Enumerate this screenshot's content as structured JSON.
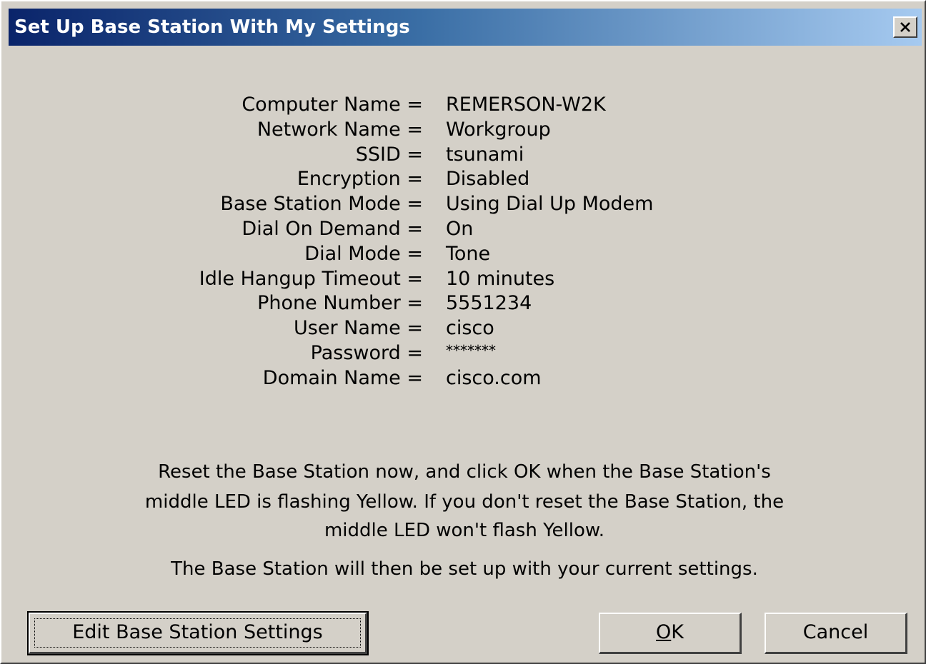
{
  "window": {
    "title": "Set Up Base Station With My Settings",
    "close_glyph": "×"
  },
  "settings": [
    {
      "label": "Computer Name =",
      "value": "REMERSON-W2K"
    },
    {
      "label": "Network Name =",
      "value": "Workgroup"
    },
    {
      "label": "SSID =",
      "value": "tsunami"
    },
    {
      "label": "Encryption =",
      "value": "Disabled"
    },
    {
      "label": "Base Station Mode =",
      "value": "Using Dial Up Modem"
    },
    {
      "label": "Dial On Demand =",
      "value": "On"
    },
    {
      "label": "Dial Mode =",
      "value": "Tone"
    },
    {
      "label": "Idle Hangup Timeout =",
      "value": "10 minutes"
    },
    {
      "label": "Phone Number =",
      "value": "5551234"
    },
    {
      "label": "User Name =",
      "value": "cisco"
    },
    {
      "label": "Password =",
      "value": "*******"
    },
    {
      "label": "Domain Name =",
      "value": "cisco.com"
    }
  ],
  "message": {
    "line1": "Reset the Base Station now, and click OK when the Base Station's",
    "line2": "middle LED is flashing Yellow. If you don't reset the Base Station, the",
    "line3": "middle LED won't flash Yellow.",
    "line4": "The Base Station will then be set up with your current settings."
  },
  "buttons": {
    "edit_label": "Edit Base Station Settings",
    "ok_label": "OK",
    "cancel_label": "Cancel"
  }
}
